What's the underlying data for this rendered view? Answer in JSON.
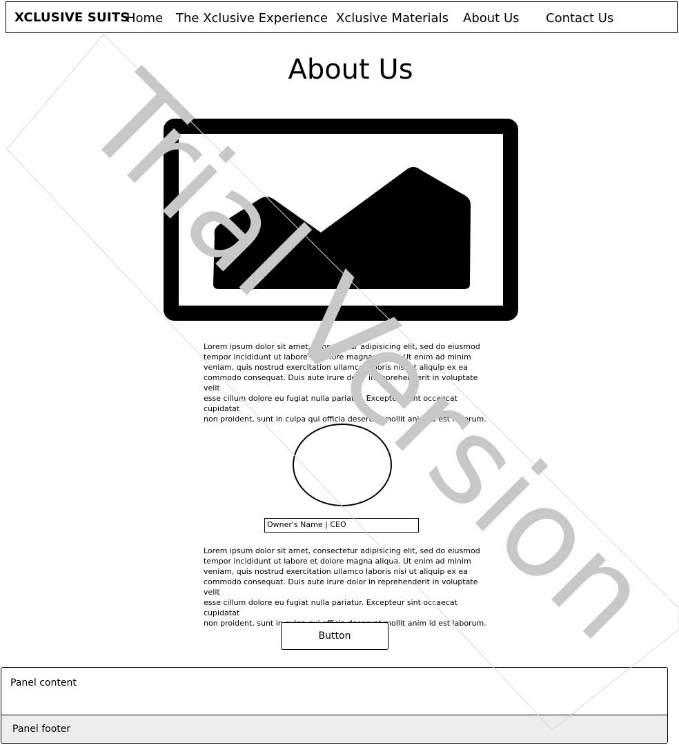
{
  "navbar": {
    "brand": "XCLUSIVE SUITS",
    "links": [
      {
        "label": "Home"
      },
      {
        "label": "The Xclusive Experience"
      },
      {
        "label": "Xclusive Materials"
      },
      {
        "label": "About Us"
      },
      {
        "label": "Contact Us"
      }
    ]
  },
  "main": {
    "title": "About Us",
    "image_icon": "image-placeholder-icon",
    "paragraph_1": "Lorem ipsum dolor sit amet, consectetur adipisicing elit, sed do eiusmod\ntempor incididunt ut labore et dolore magna aliqua. Ut enim ad minim\nveniam, quis nostrud exercitation ullamco laboris nisi ut aliquip ex ea\ncommodo consequat. Duis aute irure dolor in reprehenderit in voluptate velit\nesse cillum dolore eu fugiat nulla pariatur. Excepteur sint occaecat cupidatat\nnon proident, sunt in culpa qui officia deserunt mollit anim id est laborum.",
    "owner_caption": "Owner's Name | CEO",
    "paragraph_2": "Lorem ipsum dolor sit amet, consectetur adipisicing elit, sed do eiusmod\ntempor incididunt ut labore et dolore magna aliqua. Ut enim ad minim\nveniam, quis nostrud exercitation ullamco laboris nisi ut aliquip ex ea\ncommodo consequat. Duis aute irure dolor in reprehenderit in voluptate velit\nesse cillum dolore eu fugiat nulla pariatur. Excepteur sint occaecat cupidatat\nnon proident, sunt in culpa qui officia deserunt mollit anim id est laborum.",
    "button_label": "Button"
  },
  "panel": {
    "content": "Panel content",
    "footer": "Panel footer"
  },
  "watermark": {
    "text": "Trial Version",
    "color": "#c8c8c8"
  }
}
